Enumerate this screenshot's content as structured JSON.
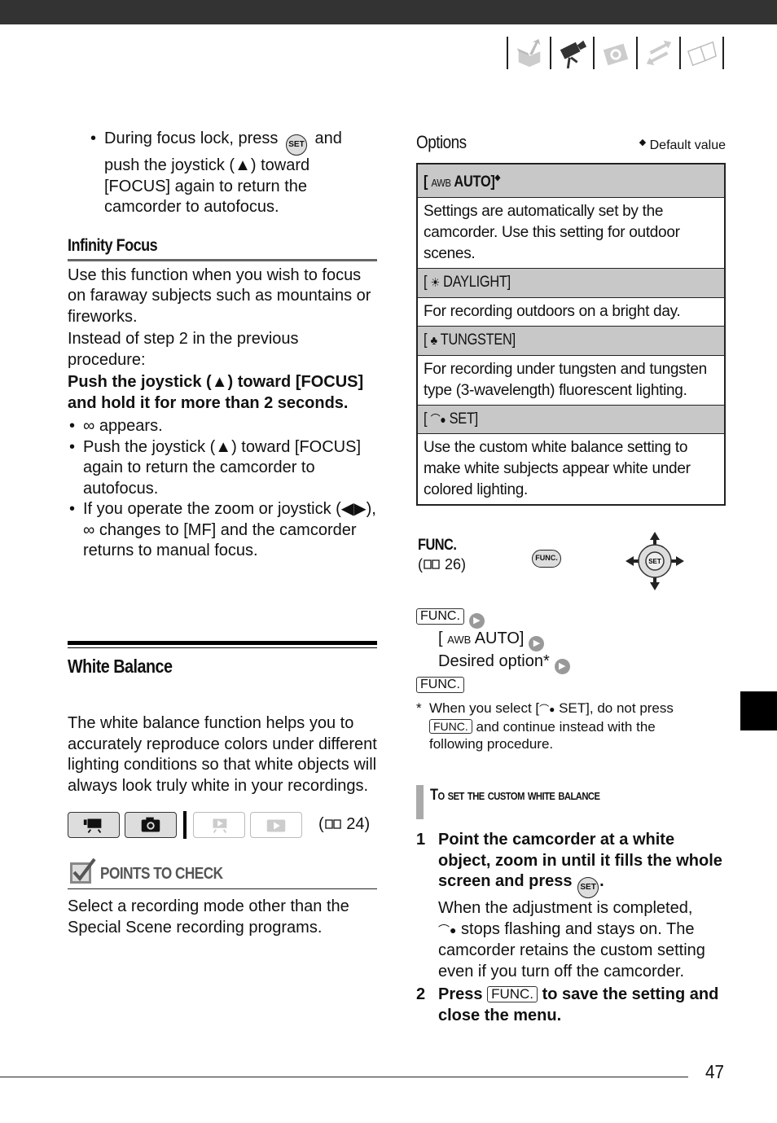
{
  "header": {
    "nav_icons": [
      "preparations-icon",
      "movie-camera-icon",
      "photo-camera-icon",
      "transfer-icon",
      "book-icon"
    ],
    "active_index": 1
  },
  "left": {
    "bullet_focus_lock": {
      "pre": "During focus lock, press",
      "set": "SET",
      "post": "and push the joystick (▲) toward [FOCUS] again to return the camcorder to autofocus."
    },
    "infinity": {
      "heading": "Infinity Focus",
      "p1": "Use this function when you wish to focus on faraway subjects such as mountains or fireworks.",
      "p2": "Instead of step 2 in the previous procedure:",
      "bold": "Push the joystick (▲) toward [FOCUS] and hold it for more than 2 seconds.",
      "bullets": [
        "∞  appears.",
        "Push the joystick (▲) toward [FOCUS] again to return the camcorder to autofocus.",
        "If you operate the zoom or joystick (◀▶), ∞ changes to [MF] and the camcorder returns to manual focus."
      ]
    },
    "white_balance": {
      "heading": "White Balance",
      "p": "The white balance function helps you to accurately reproduce colors under different lighting conditions so that white objects will always look truly white in your recordings.",
      "page_ref": "(   24)",
      "page_ref_num": "24",
      "points_heading": "POINTS TO CHECK",
      "points_text": "Select a recording mode other than the Special Scene recording programs."
    }
  },
  "right": {
    "options_title": "Options",
    "default_value": "Default value",
    "options": [
      {
        "label": "AUTO]",
        "icon": "AWB",
        "default": true,
        "desc": "Settings are automatically set by the camcorder. Use this setting for outdoor scenes."
      },
      {
        "label": "DAYLIGHT]",
        "icon": "☀",
        "default": false,
        "desc": "For recording outdoors on a bright day."
      },
      {
        "label": "TUNGSTEN]",
        "icon": "💡",
        "default": false,
        "desc": "For recording under tungsten and tungsten type (3-wavelength) fluorescent lighting."
      },
      {
        "label": "SET]",
        "icon": "custom-wb",
        "default": false,
        "desc": "Use the custom white balance setting to make white subjects appear white under colored lighting."
      }
    ],
    "func_label": "FUNC.",
    "func_ref": "26",
    "func_button": "FUNC.",
    "joystick_center": "SET",
    "steps": {
      "func1": "FUNC.",
      "auto": "AUTO]",
      "desired": "Desired option*",
      "func2": "FUNC."
    },
    "footnote": {
      "a": "When you select [",
      "b": " SET], do not press",
      "func": "FUNC.",
      "c": "and continue instead with the following procedure."
    },
    "custom_heading": "To set the custom white balance",
    "step1_bold_a": "Point the camcorder at a white object, zoom in until it fills the whole screen and press",
    "step1_text": "When the adjustment is completed,",
    "step1_text2": "stops flashing and stays on. The camcorder retains the custom setting even if you turn off the camcorder.",
    "step2_a": "Press",
    "step2_func": "FUNC.",
    "step2_b": "to save the setting and close the menu."
  },
  "footer": {
    "page_number": "47"
  }
}
